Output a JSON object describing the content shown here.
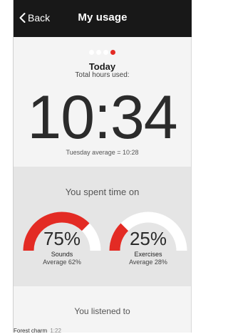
{
  "colors": {
    "accent": "#e32b24",
    "navbar": "#181818",
    "track": "#ffffff"
  },
  "header": {
    "back_label": "Back",
    "title": "My usage"
  },
  "pager": {
    "total": 4,
    "active_index": 3
  },
  "today": {
    "title": "Today",
    "subtitle": "Total hours used:",
    "time": "10:34",
    "average": "Tuesday average = 10:28"
  },
  "spent": {
    "title": "You spent time on",
    "gauges": [
      {
        "percent_label": "75%",
        "fraction": 0.75,
        "name": "Sounds",
        "average": "Average 62%"
      },
      {
        "percent_label": "25%",
        "fraction": 0.25,
        "name": "Exercises",
        "average": "Average 28%"
      }
    ]
  },
  "listened": {
    "title": "You listened to",
    "first_track": {
      "name": "Forest charm",
      "duration": "1:22"
    }
  }
}
